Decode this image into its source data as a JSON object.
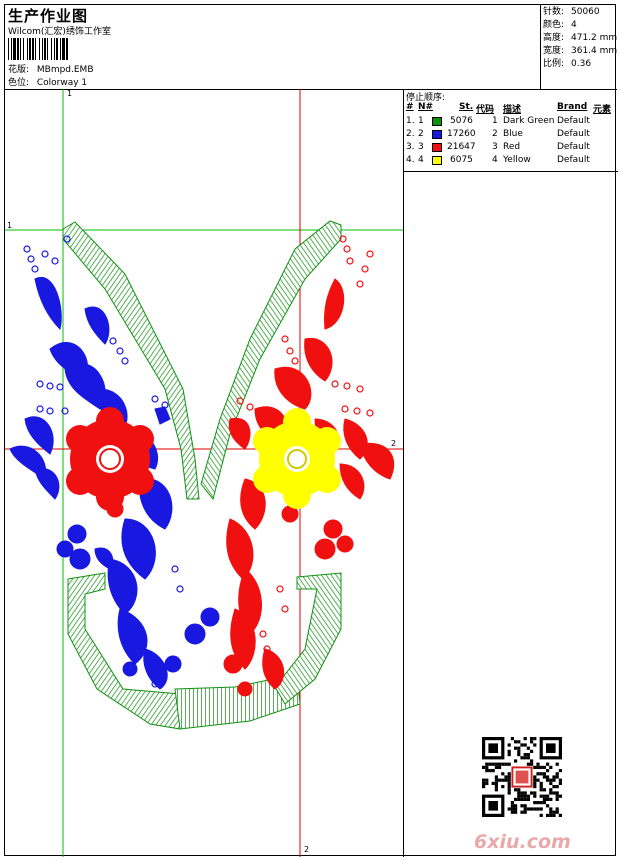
{
  "header": {
    "title": "生产作业图",
    "company": "Wilcom(汇宏)绣饰工作室",
    "design_label": "花版:",
    "design_value": "MBmpd.EMB",
    "colorway_label": "色位:",
    "colorway_value": "Colorway 1"
  },
  "stats": [
    {
      "label": "针数:",
      "value": "50060"
    },
    {
      "label": "颜色:",
      "value": "4"
    },
    {
      "label": "高度:",
      "value": "471.2 mm"
    },
    {
      "label": "宽度:",
      "value": "361.4 mm"
    },
    {
      "label": "比例:",
      "value": "0.36"
    }
  ],
  "thread_table": {
    "title": "停止顺序:",
    "headers": {
      "num": "#",
      "n": "N#",
      "st": "St.",
      "code": "代码",
      "desc": "描述",
      "brand": "Brand",
      "elem": "元素"
    },
    "rows": [
      {
        "num": "1.",
        "n": "1",
        "color": "#109010",
        "st": "5076",
        "code": "1",
        "desc": "Dark Green",
        "brand": "Default"
      },
      {
        "num": "2.",
        "n": "2",
        "color": "#1818e0",
        "st": "17260",
        "code": "2",
        "desc": "Blue",
        "brand": "Default"
      },
      {
        "num": "3.",
        "n": "3",
        "color": "#f01010",
        "st": "21647",
        "code": "3",
        "desc": "Red",
        "brand": "Default"
      },
      {
        "num": "4.",
        "n": "4",
        "color": "#ffff00",
        "st": "6075",
        "code": "4",
        "desc": "Yellow",
        "brand": "Default"
      }
    ]
  },
  "guides": {
    "top_left": "1",
    "left_top": "1",
    "right_mid": "2",
    "bottom": "2"
  },
  "watermark": "6xiu.com",
  "colors": {
    "green": "#109010",
    "blue": "#1818e0",
    "red": "#f01010",
    "yellow": "#ffff00",
    "guide_green": "#00c000",
    "guide_red": "#e00000"
  }
}
